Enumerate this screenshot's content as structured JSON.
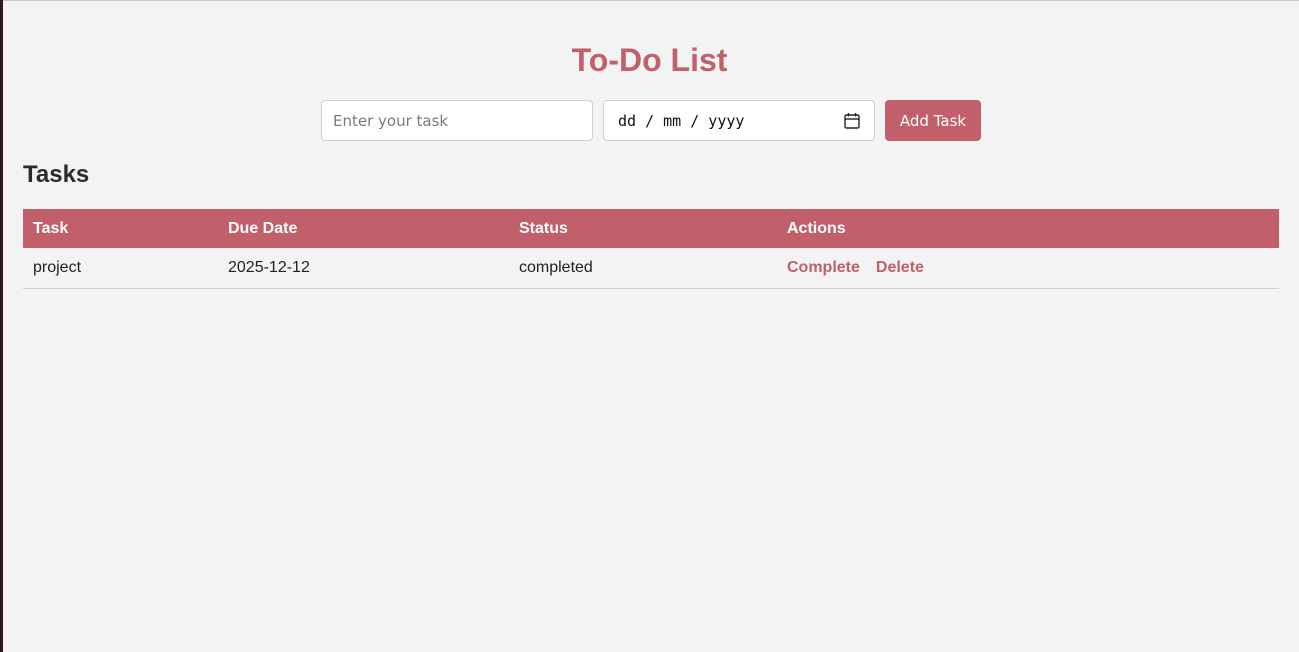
{
  "app": {
    "title": "To-Do List"
  },
  "form": {
    "task_placeholder": "Enter your task",
    "task_value": "",
    "date_placeholder": "dd / mm / yyyy",
    "add_label": "Add Task"
  },
  "tasks_section": {
    "title": "Tasks",
    "headers": {
      "task": "Task",
      "due_date": "Due Date",
      "status": "Status",
      "actions": "Actions"
    },
    "rows": [
      {
        "task": "project",
        "due_date": "2025-12-12",
        "status": "completed",
        "complete_label": "Complete",
        "delete_label": "Delete"
      }
    ]
  },
  "icons": {
    "date_picker": "calendar-icon"
  },
  "colors": {
    "accent": "#c1606a",
    "background": "#f3f3f3"
  }
}
